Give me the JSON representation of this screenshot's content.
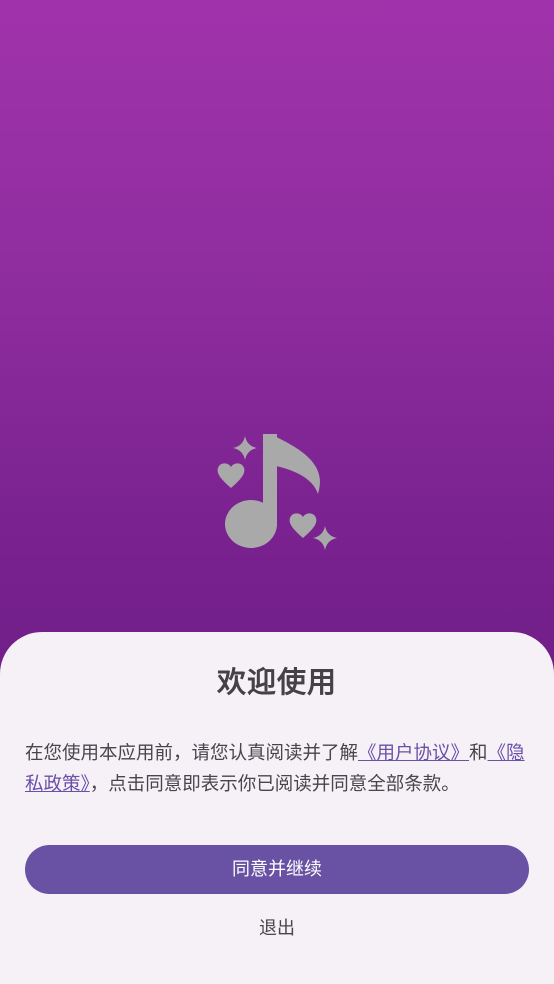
{
  "colors": {
    "gradient_top": "#a033ab",
    "gradient_bottom": "#6f1e88",
    "sheet_background": "#f6f1f7",
    "primary_button": "#6951a4",
    "link": "#6a50a7",
    "logo_gray": "#a9a9a9"
  },
  "logo": {
    "icon": "music-note-hearts-sparkles-icon"
  },
  "dialog": {
    "title": "欢迎使用",
    "notice": {
      "prefix": "在您使用本应用前，请您认真阅读并了解",
      "user_agreement_link": "《用户协议》",
      "conjunction": "和",
      "privacy_policy_link": "《隐私政策》",
      "suffix": "，点击同意即表示你已阅读并同意全部条款。"
    },
    "agree_button_label": "同意并继续",
    "exit_button_label": "退出"
  }
}
